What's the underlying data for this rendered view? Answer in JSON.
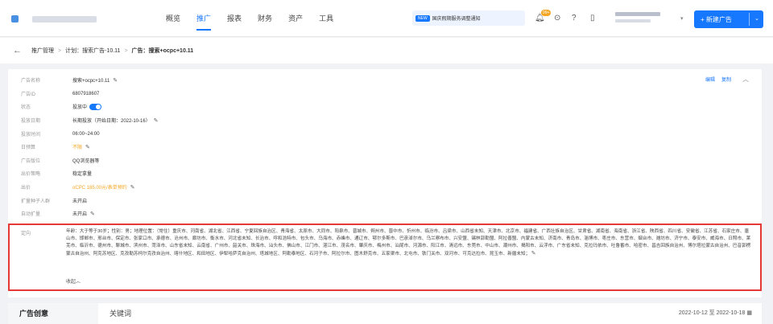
{
  "nav": {
    "items": [
      "概览",
      "推广",
      "报表",
      "财务",
      "资产",
      "工具"
    ],
    "active_index": 1
  },
  "notice": {
    "tag": "NEW",
    "text": "国庆假期服务调整通知"
  },
  "header": {
    "badge": "99+",
    "new_button": "+ 新建广告"
  },
  "breadcrumb": {
    "root": "推广管理",
    "plan": "计划：搜索广告-10.11",
    "ad": "广告：搜索+ocpc+10.11"
  },
  "card": {
    "actions": {
      "edit": "编辑",
      "copy": "复制"
    },
    "fields": [
      {
        "k": "广告名称",
        "v": "搜索+ocpc+10.11",
        "edit": true
      },
      {
        "k": "广告ID",
        "v": "6807918607"
      },
      {
        "k": "状态",
        "v": "投放中",
        "toggle": true
      },
      {
        "k": "投放日期",
        "v": "长期投放（开始日期：2022-10-16）",
        "edit": true
      },
      {
        "k": "投放时间",
        "v": "06:00~24:00"
      },
      {
        "k": "日预算",
        "v": "不限",
        "edit": true,
        "orange": true
      },
      {
        "k": "广告版位",
        "v": "QQ浏览器等"
      },
      {
        "k": "出价策略",
        "v": "稳定拿量"
      },
      {
        "k": "出价",
        "v": "oCPC 185.00元/表单预约",
        "edit": true,
        "orange": true
      },
      {
        "k": "扩量种子人群",
        "v": "未开启"
      },
      {
        "k": "自动扩量",
        "v": "未开启",
        "edit": true
      }
    ],
    "targeting": {
      "k": "定向",
      "text": "年龄：大于等于30岁；性别：男；地理位置：（常住）重庆市、河南省、湖北省、江西省、宁夏回族自治区、青海省、太原市、大同市、阳泉市、晋城市、朔州市、晋中市、忻州市、临汾市、吕梁市、山西省未知、天津市、北京市、福建省、广西壮族自治区、甘肃省、湖南省、海南省、浙江省、陕西省、四川省、安徽省、江苏省、石家庄市、唐山市、邯郸市、邢台市、保定市、张家口市、承德市、沧州市、廊坊市、衡水市、河北省未知、长治市、呼和浩特市、包头市、乌海市、赤峰市、通辽市、鄂尔多斯市、巴彦淖尔市、乌兰察布市、兴安盟、锡林郭勒盟、阿拉善盟、内蒙古未知、济南市、青岛市、淄博市、枣庄市、东营市、烟台市、潍坊市、济宁市、泰安市、威海市、日照市、莱芜市、临沂市、德州市、聊城市、滨州市、菏泽市、山东省未知、云南省、广州市、韶关市、珠海市、汕头市、佛山市、江门市、湛江市、茂名市、肇庆市、梅州市、汕尾市、河源市、阳江市、清远市、东莞市、中山市、潮州市、揭阳市、云浮市、广东省未知、克拉玛依市、吐鲁番市、哈密市、昌吉回族自治州、博尔塔拉蒙古自治州、巴音郭楞蒙古自治州、阿克苏地区、克孜勒苏柯尔克孜自治州、喀什地区、和田地区、伊犁哈萨克自治州、塔城地区、阿勒泰地区、石河子市、阿拉尔市、图木舒克市、五家渠市、北屯市、铁门关市、双河市、可克达拉市、昆玉市、新疆未知；",
      "fold": "收起"
    }
  },
  "tabs": {
    "creative": "广告创意",
    "keywords": "关键词"
  },
  "daterange": "2022-10-12 至 2022-10-18"
}
